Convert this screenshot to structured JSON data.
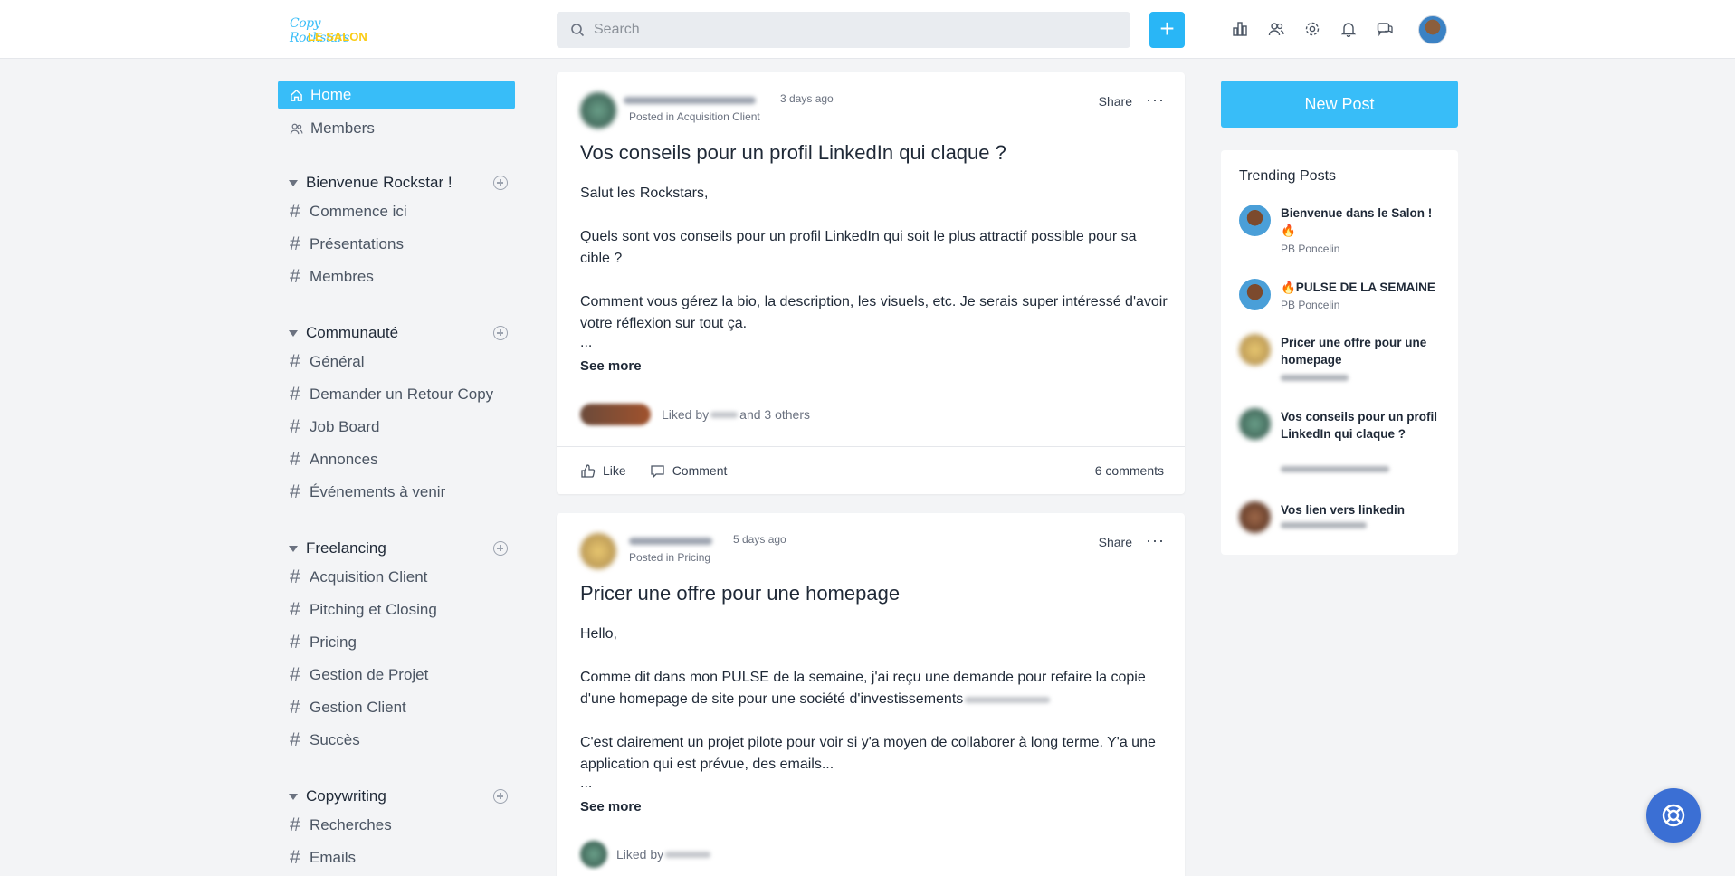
{
  "header": {
    "logo_line1": "Copy Rockstars",
    "logo_line2": "LE SALON",
    "search_placeholder": "Search",
    "plus_label": "+"
  },
  "sidebar": {
    "home": "Home",
    "members": "Members",
    "sections": [
      {
        "title": "Bienvenue Rockstar !",
        "channels": [
          "Commence ici",
          "Présentations",
          "Membres"
        ]
      },
      {
        "title": "Communauté",
        "channels": [
          "Général",
          "Demander un Retour Copy",
          "Job Board",
          "Annonces",
          "Événements à venir"
        ]
      },
      {
        "title": "Freelancing",
        "channels": [
          "Acquisition Client",
          "Pitching et Closing",
          "Pricing",
          "Gestion de Projet",
          "Gestion Client",
          "Succès"
        ]
      },
      {
        "title": "Copywriting",
        "channels": [
          "Recherches",
          "Emails"
        ]
      }
    ],
    "hash": "#"
  },
  "posts": [
    {
      "time": "3 days ago",
      "posted_in": "Posted in Acquisition Client",
      "share": "Share",
      "dots": "···",
      "title": "Vos conseils pour un profil LinkedIn qui claque ?",
      "body": [
        "Salut les Rockstars,",
        "Quels sont vos conseils pour un profil LinkedIn qui soit le plus attractif possible pour sa cible ?",
        "Comment vous gérez la bio, la description, les visuels, etc. Je serais super intéressé d'avoir votre réflexion sur tout ça.",
        "..."
      ],
      "see_more": "See more",
      "liked_prefix": "Liked by",
      "liked_suffix": "and 3 others",
      "like": "Like",
      "comment": "Comment",
      "comments_count": "6 comments"
    },
    {
      "time": "5 days ago",
      "posted_in": "Posted in Pricing",
      "share": "Share",
      "dots": "···",
      "title": "Pricer une offre pour une homepage",
      "body": [
        "Hello,",
        "Comme dit dans mon PULSE de la semaine, j'ai reçu une demande pour refaire la copie d'une homepage de site pour une société d'investissements",
        "C'est clairement un projet pilote pour voir si y'a moyen de collaborer à long terme. Y'a une application qui est prévue, des emails...",
        "..."
      ],
      "see_more": "See more",
      "liked_prefix": "Liked by"
    }
  ],
  "right": {
    "new_post": "New Post",
    "trending_title": "Trending Posts",
    "items": [
      {
        "title": "Bienvenue dans le Salon ! 🔥",
        "author": "PB Poncelin"
      },
      {
        "title": "🔥PULSE DE LA SEMAINE",
        "author": "PB Poncelin"
      },
      {
        "title": "Pricer une offre pour une homepage"
      },
      {
        "title": "Vos conseils pour un profil LinkedIn qui claque ?"
      },
      {
        "title": "Vos lien vers linkedin"
      }
    ]
  },
  "colors": {
    "accent": "#38bdf8",
    "help_button": "#3b6fd4"
  }
}
